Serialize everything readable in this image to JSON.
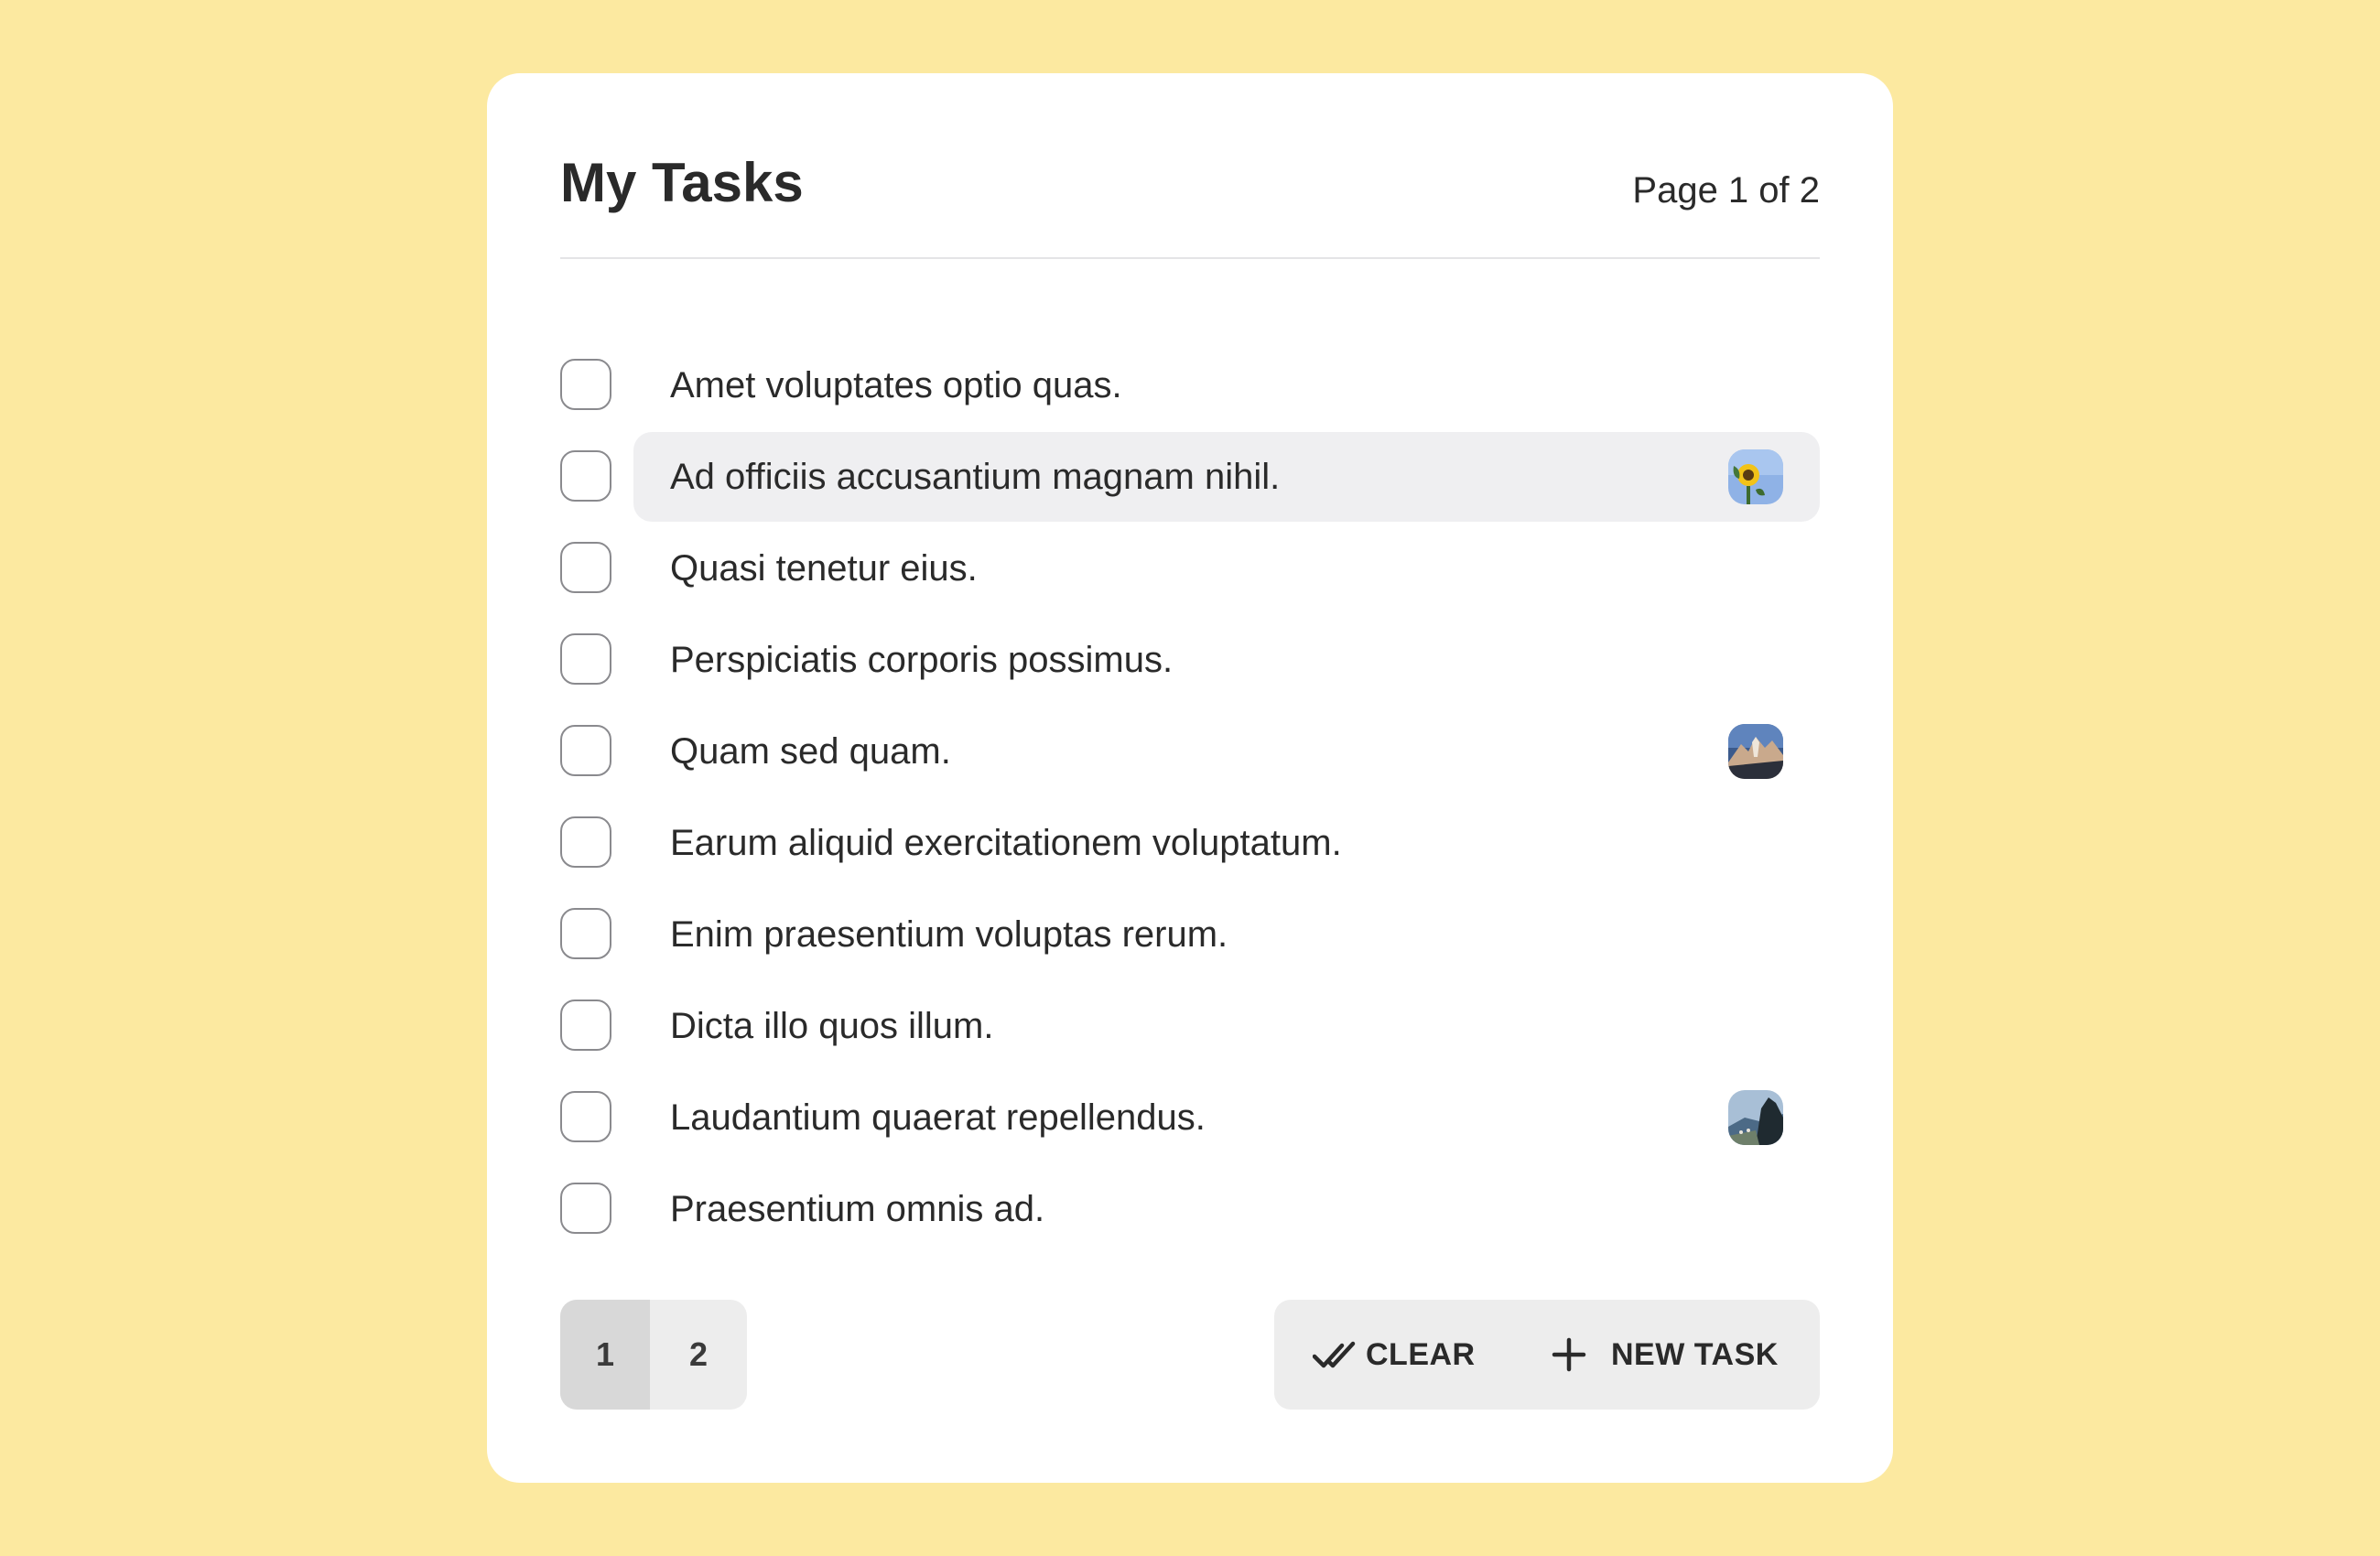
{
  "header": {
    "title": "My Tasks",
    "page_info": "Page 1 of 2"
  },
  "tasks": [
    {
      "label": "Amet voluptates optio quas.",
      "checked": false,
      "thumbnail": null
    },
    {
      "label": "Ad officiis accusantium magnam nihil.",
      "checked": false,
      "thumbnail": "sunflower-photo",
      "highlighted": true
    },
    {
      "label": "Quasi tenetur eius.",
      "checked": false,
      "thumbnail": null
    },
    {
      "label": "Perspiciatis corporis possimus.",
      "checked": false,
      "thumbnail": null
    },
    {
      "label": "Quam sed quam.",
      "checked": false,
      "thumbnail": "mountain-photo"
    },
    {
      "label": "Earum aliquid exercitationem voluptatum.",
      "checked": false,
      "thumbnail": null
    },
    {
      "label": "Enim praesentium voluptas rerum.",
      "checked": false,
      "thumbnail": null
    },
    {
      "label": "Dicta illo quos illum.",
      "checked": false,
      "thumbnail": null
    },
    {
      "label": "Laudantium quaerat repellendus.",
      "checked": false,
      "thumbnail": "coast-photo"
    },
    {
      "label": "Praesentium omnis ad.",
      "checked": false,
      "thumbnail": null
    }
  ],
  "pagination": {
    "pages": [
      "1",
      "2"
    ],
    "current": "1"
  },
  "actions": {
    "clear_label": "CLEAR",
    "clear_icon": "double-check-icon",
    "new_task_label": "NEW TASK",
    "new_task_icon": "plus-icon"
  },
  "colors": {
    "background": "#fce9a0",
    "card": "#ffffff",
    "highlight_row": "#efeff1",
    "button_bg": "#ededed",
    "active_page": "#d8d8d8"
  }
}
